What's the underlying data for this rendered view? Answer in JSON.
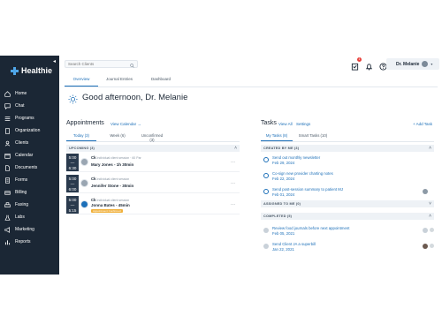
{
  "sidebar": {
    "collapse_icon": "◂",
    "brand": "Healthie",
    "items": [
      {
        "label": "Home",
        "icon": "home-icon"
      },
      {
        "label": "Chat",
        "icon": "chat-icon"
      },
      {
        "label": "Programs",
        "icon": "programs-icon"
      },
      {
        "label": "Organization",
        "icon": "organization-icon"
      },
      {
        "label": "Clients",
        "icon": "clients-icon"
      },
      {
        "label": "Calendar",
        "icon": "calendar-icon"
      },
      {
        "label": "Documents",
        "icon": "documents-icon"
      },
      {
        "label": "Forms",
        "icon": "forms-icon"
      },
      {
        "label": "Billing",
        "icon": "billing-icon"
      },
      {
        "label": "Faxing",
        "icon": "faxing-icon"
      },
      {
        "label": "Labs",
        "icon": "labs-icon"
      },
      {
        "label": "Marketing",
        "icon": "marketing-icon"
      },
      {
        "label": "Reports",
        "icon": "reports-icon"
      }
    ]
  },
  "topbar": {
    "search_placeholder": "Search Clients",
    "notification_count": "1",
    "user_name": "Dr. Melanie"
  },
  "main": {
    "tabs": [
      "Overview",
      "Journal Entries",
      "Dashboard"
    ],
    "greeting": "Good afternoon, Dr. Melanie"
  },
  "appointments": {
    "title": "Appointments",
    "view_link": "View Calendar →",
    "tabs": [
      "Today (3)",
      "Week (6)",
      "Unconfirmed (3)"
    ],
    "group_label": "UPCOMING (3)",
    "items": [
      {
        "time": [
          "5:00",
          "—",
          "6:30"
        ],
        "type": "Ck",
        "meta": "Individual client session · 60 Par",
        "name": "Mary Jones - 1h 30min",
        "tag": ""
      },
      {
        "time": [
          "5:00",
          "—",
          "6:00"
        ],
        "type": "Ck",
        "meta": "Individual client session",
        "name": "Jennifer Stone - 30min",
        "tag": ""
      },
      {
        "time": [
          "5:00",
          "—",
          "5:15"
        ],
        "type": "Ck",
        "meta": "Individual client session",
        "name": "Jonna Bates - 45min",
        "tag": "Appointment Confirmed"
      }
    ]
  },
  "tasks": {
    "title": "Tasks",
    "view_link": "View All",
    "settings_link": "Settings",
    "add_link": "+ Add Task",
    "tabs": [
      "My Tasks (8)",
      "Smart Tasks (10)"
    ],
    "groups": {
      "created": "CREATED BY ME (3)",
      "assigned": "ASSIGNED TO ME (0)",
      "completed": "COMPLETED (5)"
    },
    "created_items": [
      {
        "title": "Send out monthly newsletter",
        "date": "Feb 29, 2024"
      },
      {
        "title": "Co-sign new provider charting notes",
        "date": "Feb 22, 2024"
      },
      {
        "title": "Send post-session summary to patient MJ",
        "date": "Feb 01, 2024"
      }
    ],
    "completed_items": [
      {
        "title": "Review food journals before next appointment",
        "date": "Feb 05, 2021"
      },
      {
        "title": "Send Client JA a superbill",
        "date": "Jan 22, 2021"
      }
    ]
  },
  "colors": {
    "sidebar_bg": "#1b2735",
    "accent": "#1c6fb8",
    "brand_mark": "#4fa6e8",
    "tag_bg": "#f0b03c",
    "badge": "#e8403a"
  }
}
